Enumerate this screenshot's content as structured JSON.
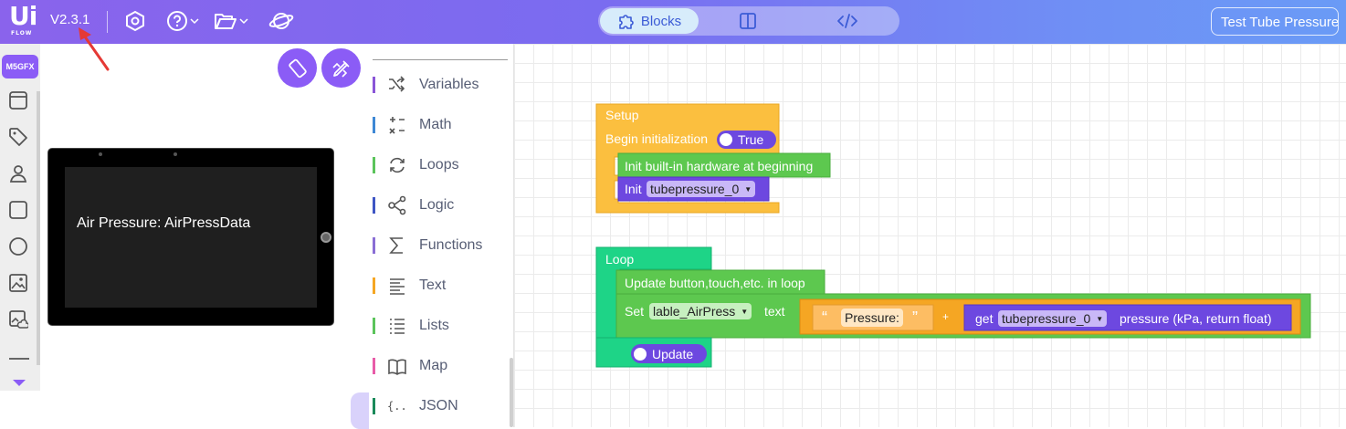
{
  "header": {
    "version": "V2.3.1",
    "logo_text": "Ui",
    "logo_sub": "FLOW",
    "tabs": [
      {
        "label": "Blocks",
        "icon": "puzzle-icon"
      },
      {
        "label": "",
        "icon": "split-view-icon"
      },
      {
        "label": "",
        "icon": "code-icon"
      }
    ],
    "project_name": "Test Tube Pressure"
  },
  "left_strip": {
    "device_badge": "M5GFX",
    "tools": [
      "window-icon",
      "tag-icon",
      "image-person-icon",
      "rectangle-icon",
      "circle-icon",
      "image-icon",
      "image-cloud-icon"
    ]
  },
  "device": {
    "screen_text": "Air Pressure: AirPressData"
  },
  "categories": [
    {
      "label": "Variables",
      "color": "#8a55d7",
      "icon": "shuffle-icon"
    },
    {
      "label": "Math",
      "color": "#3e88d5",
      "icon": "math-icon"
    },
    {
      "label": "Loops",
      "color": "#5bc45b",
      "icon": "loop-icon"
    },
    {
      "label": "Logic",
      "color": "#3e55c4",
      "icon": "logic-icon"
    },
    {
      "label": "Functions",
      "color": "#8a6ed5",
      "icon": "sigma-icon"
    },
    {
      "label": "Text",
      "color": "#f5a623",
      "icon": "text-icon"
    },
    {
      "label": "Lists",
      "color": "#5bc45b",
      "icon": "list-icon"
    },
    {
      "label": "Map",
      "color": "#e85ca8",
      "icon": "map-icon"
    },
    {
      "label": "JSON",
      "color": "#1a8a5a",
      "icon": "json-icon"
    }
  ],
  "blocks": {
    "setup": {
      "title": "Setup",
      "begin_label": "Begin initialization",
      "begin_value": "True",
      "init_hw": "Init built-in hardware at beginning",
      "init_label": "Init",
      "init_var": "tubepressure_0"
    },
    "loop": {
      "title": "Loop",
      "update_label": "Update button,touch,etc. in loop",
      "set_label": "Set",
      "set_target": "lable_AirPress",
      "set_prop": "text",
      "string_value": "Pressure:",
      "plus": "+",
      "get_label": "get",
      "get_var": "tubepressure_0",
      "get_desc": "pressure (kPa, return float)",
      "update_toggle": "Update"
    }
  },
  "colors": {
    "accent": "#8b5cf6",
    "setup": "#fbbf3f",
    "loop": "#1ed487",
    "green_block": "#5dc84f",
    "purple_block": "#6d48e0",
    "orange_text": "#f5a623"
  }
}
